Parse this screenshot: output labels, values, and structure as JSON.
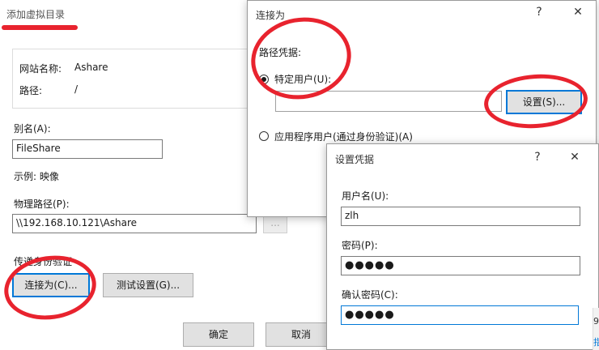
{
  "main_dialog": {
    "title": "添加虚拟目录",
    "site_name_label": "网站名称:",
    "site_name_value": "Ashare",
    "path_label": "路径:",
    "path_value": "/",
    "alias_label": "别名(A):",
    "alias_value": "FileShare",
    "example_text": "示例: 映像",
    "physical_path_label": "物理路径(P):",
    "physical_path_value": "\\\\192.168.10.121\\Ashare",
    "browse_label": "...",
    "passthrough_label": "传递身份验证",
    "connect_as_label": "连接为(C)...",
    "test_settings_label": "测试设置(G)...",
    "ok_label": "确定",
    "cancel_label": "取消"
  },
  "connect_as_dialog": {
    "title": "连接为",
    "help_button": "?",
    "close_button": "✕",
    "credentials_label": "路径凭据:",
    "specific_user_label": "特定用户(U):",
    "specific_user_value": "",
    "set_button_label": "设置(S)...",
    "app_user_label": "应用程序用户(通过身份验证)(A)",
    "selected": "specific_user"
  },
  "set_credentials_dialog": {
    "title": "设置凭据",
    "help_button": "?",
    "close_button": "✕",
    "username_label": "用户名(U):",
    "username_value": "zlh",
    "password_label": "密码(P):",
    "password_value": "●●●●●",
    "confirm_password_label": "确认密码(C):",
    "confirm_password_value": "●●●●●"
  },
  "background_edge": {
    "fragment_1": "9",
    "fragment_2": "指"
  },
  "annotation_color": "#e8232e",
  "accent_color": "#0078d7"
}
